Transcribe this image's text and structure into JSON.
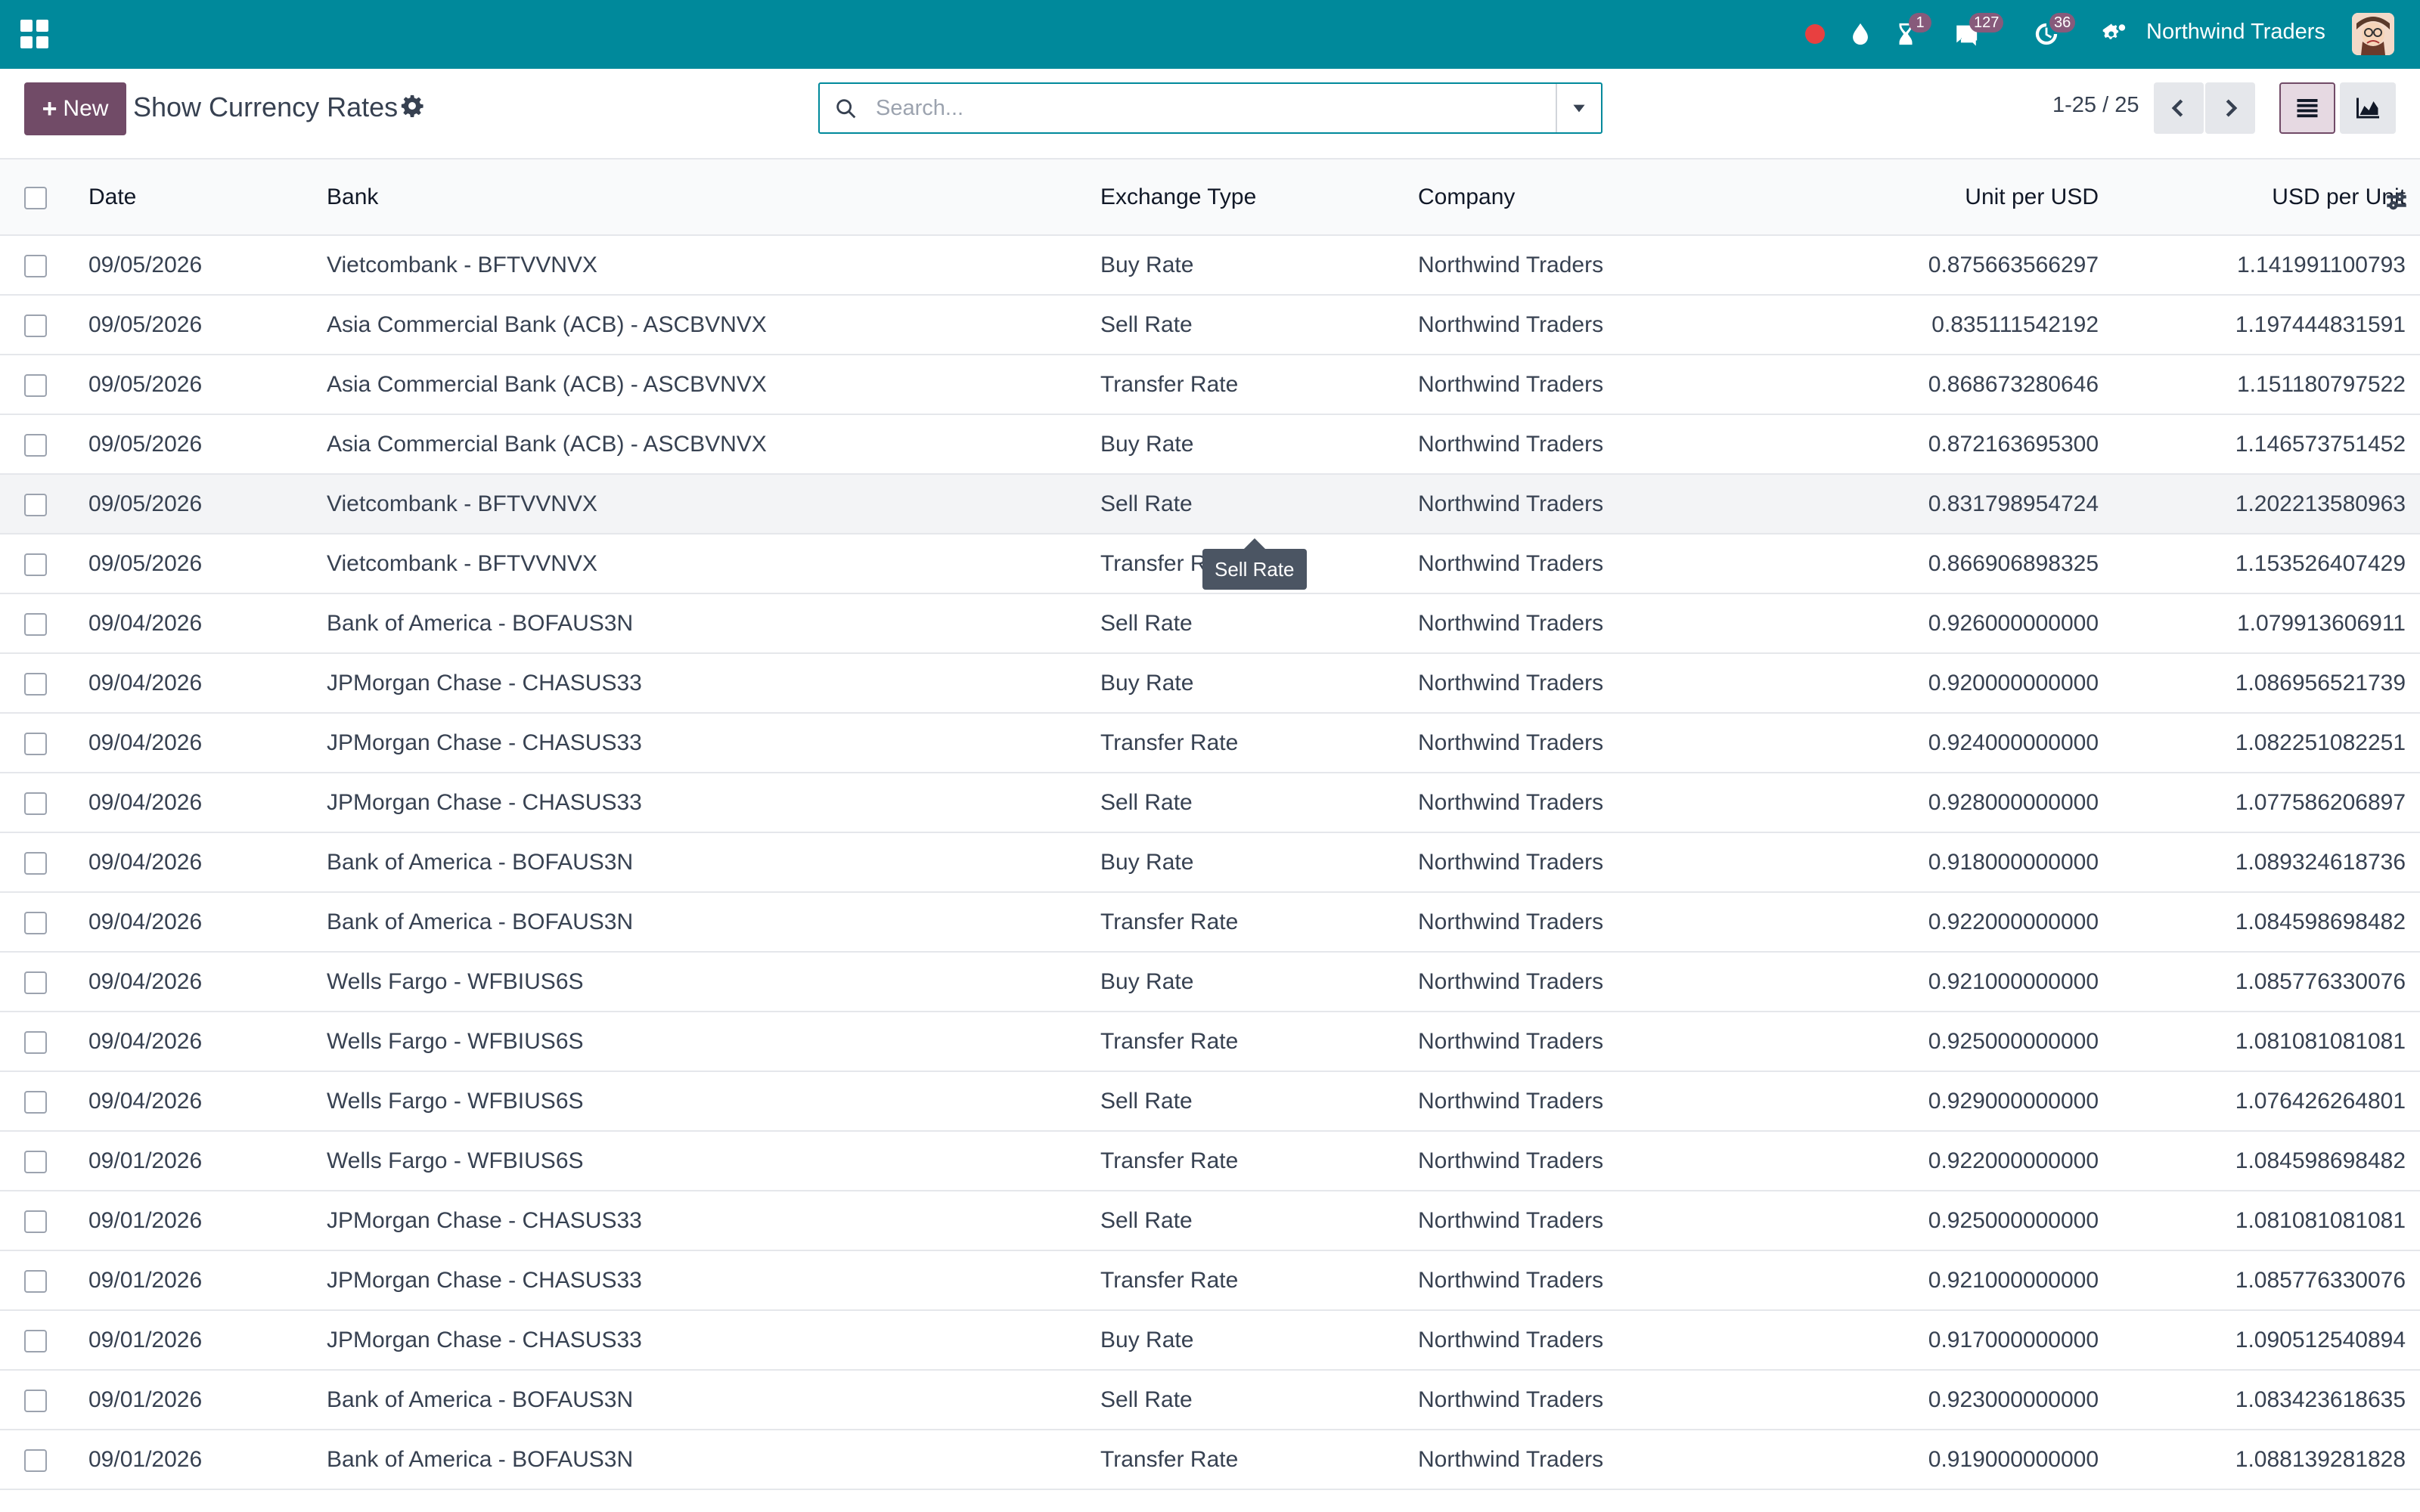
{
  "navbar": {
    "company": "Northwind Traders",
    "badges": {
      "activities": "1",
      "messages": "127",
      "timer": "36"
    },
    "colors": {
      "bar": "#00899b",
      "badge": "#875a7b",
      "record": "#e84040"
    }
  },
  "control": {
    "new_label": "New",
    "title": "Show Currency Rates",
    "search_placeholder": "Search...",
    "pager": "1-25 / 25"
  },
  "table": {
    "columns": {
      "date": "Date",
      "bank": "Bank",
      "exchange_type": "Exchange Type",
      "company": "Company",
      "unit_per_usd": "Unit per USD",
      "usd_per_unit": "USD per Unit"
    },
    "rows": [
      {
        "date": "09/05/2026",
        "bank": "Vietcombank - BFTVVNVX",
        "type": "Buy Rate",
        "company": "Northwind Traders",
        "unit": "0.875663566297",
        "usd": "1.141991100793"
      },
      {
        "date": "09/05/2026",
        "bank": "Asia Commercial Bank (ACB) - ASCBVNVX",
        "type": "Sell Rate",
        "company": "Northwind Traders",
        "unit": "0.835111542192",
        "usd": "1.197444831591"
      },
      {
        "date": "09/05/2026",
        "bank": "Asia Commercial Bank (ACB) - ASCBVNVX",
        "type": "Transfer Rate",
        "company": "Northwind Traders",
        "unit": "0.868673280646",
        "usd": "1.151180797522"
      },
      {
        "date": "09/05/2026",
        "bank": "Asia Commercial Bank (ACB) - ASCBVNVX",
        "type": "Buy Rate",
        "company": "Northwind Traders",
        "unit": "0.872163695300",
        "usd": "1.146573751452"
      },
      {
        "date": "09/05/2026",
        "bank": "Vietcombank - BFTVVNVX",
        "type": "Sell Rate",
        "company": "Northwind Traders",
        "unit": "0.831798954724",
        "usd": "1.202213580963"
      },
      {
        "date": "09/05/2026",
        "bank": "Vietcombank - BFTVVNVX",
        "type": "Transfer Rate",
        "company": "Northwind Traders",
        "unit": "0.866906898325",
        "usd": "1.153526407429"
      },
      {
        "date": "09/04/2026",
        "bank": "Bank of America - BOFAUS3N",
        "type": "Sell Rate",
        "company": "Northwind Traders",
        "unit": "0.926000000000",
        "usd": "1.079913606911"
      },
      {
        "date": "09/04/2026",
        "bank": "JPMorgan Chase - CHASUS33",
        "type": "Buy Rate",
        "company": "Northwind Traders",
        "unit": "0.920000000000",
        "usd": "1.086956521739"
      },
      {
        "date": "09/04/2026",
        "bank": "JPMorgan Chase - CHASUS33",
        "type": "Transfer Rate",
        "company": "Northwind Traders",
        "unit": "0.924000000000",
        "usd": "1.082251082251"
      },
      {
        "date": "09/04/2026",
        "bank": "JPMorgan Chase - CHASUS33",
        "type": "Sell Rate",
        "company": "Northwind Traders",
        "unit": "0.928000000000",
        "usd": "1.077586206897"
      },
      {
        "date": "09/04/2026",
        "bank": "Bank of America - BOFAUS3N",
        "type": "Buy Rate",
        "company": "Northwind Traders",
        "unit": "0.918000000000",
        "usd": "1.089324618736"
      },
      {
        "date": "09/04/2026",
        "bank": "Bank of America - BOFAUS3N",
        "type": "Transfer Rate",
        "company": "Northwind Traders",
        "unit": "0.922000000000",
        "usd": "1.084598698482"
      },
      {
        "date": "09/04/2026",
        "bank": "Wells Fargo - WFBIUS6S",
        "type": "Buy Rate",
        "company": "Northwind Traders",
        "unit": "0.921000000000",
        "usd": "1.085776330076"
      },
      {
        "date": "09/04/2026",
        "bank": "Wells Fargo - WFBIUS6S",
        "type": "Transfer Rate",
        "company": "Northwind Traders",
        "unit": "0.925000000000",
        "usd": "1.081081081081"
      },
      {
        "date": "09/04/2026",
        "bank": "Wells Fargo - WFBIUS6S",
        "type": "Sell Rate",
        "company": "Northwind Traders",
        "unit": "0.929000000000",
        "usd": "1.076426264801"
      },
      {
        "date": "09/01/2026",
        "bank": "Wells Fargo - WFBIUS6S",
        "type": "Transfer Rate",
        "company": "Northwind Traders",
        "unit": "0.922000000000",
        "usd": "1.084598698482"
      },
      {
        "date": "09/01/2026",
        "bank": "JPMorgan Chase - CHASUS33",
        "type": "Sell Rate",
        "company": "Northwind Traders",
        "unit": "0.925000000000",
        "usd": "1.081081081081"
      },
      {
        "date": "09/01/2026",
        "bank": "JPMorgan Chase - CHASUS33",
        "type": "Transfer Rate",
        "company": "Northwind Traders",
        "unit": "0.921000000000",
        "usd": "1.085776330076"
      },
      {
        "date": "09/01/2026",
        "bank": "JPMorgan Chase - CHASUS33",
        "type": "Buy Rate",
        "company": "Northwind Traders",
        "unit": "0.917000000000",
        "usd": "1.090512540894"
      },
      {
        "date": "09/01/2026",
        "bank": "Bank of America - BOFAUS3N",
        "type": "Sell Rate",
        "company": "Northwind Traders",
        "unit": "0.923000000000",
        "usd": "1.083423618635"
      },
      {
        "date": "09/01/2026",
        "bank": "Bank of America - BOFAUS3N",
        "type": "Transfer Rate",
        "company": "Northwind Traders",
        "unit": "0.919000000000",
        "usd": "1.088139281828"
      }
    ]
  },
  "tooltip": {
    "text": "Sell Rate"
  }
}
